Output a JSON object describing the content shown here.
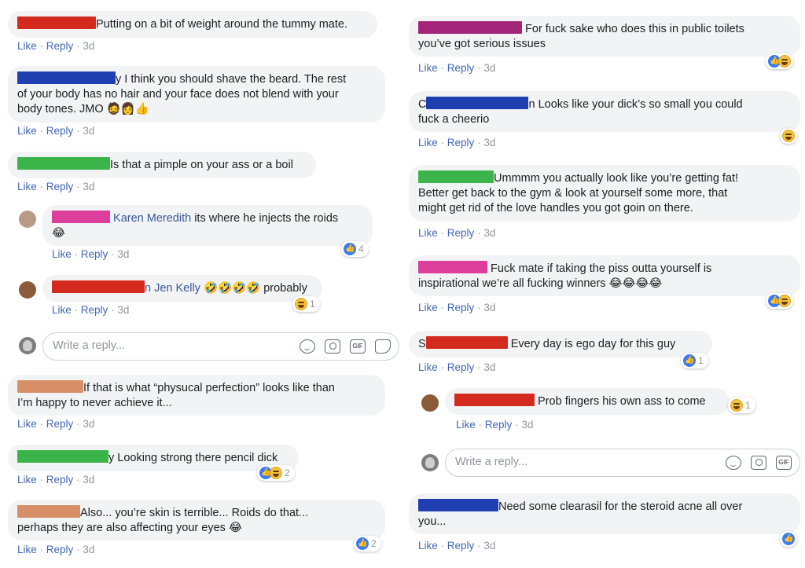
{
  "labels": {
    "like": "Like",
    "reply": "Reply",
    "sep": "·",
    "time": "3d"
  },
  "redact_colors": {
    "red": "#d42a1e",
    "blue": "#1f3fb0",
    "green": "#3bb54a",
    "pink": "#db3e9b",
    "tan": "#d68f66",
    "purple": "#a3257a"
  },
  "left": {
    "c1": {
      "text": "Putting on a bit of weight around the tummy mate."
    },
    "c2": {
      "line1": "y I think you should shave the beard. The rest",
      "line2": "of your body has no hair and your face does not blend with your",
      "line3": "body tones. JMO 🧔👩👍"
    },
    "c3": {
      "text": "Is that a pimple on your ass or a boil"
    },
    "c4": {
      "name": "Karen Meredith",
      "text": " its where he injects the roids",
      "emoji": "😂",
      "react_count": "4"
    },
    "c5": {
      "name": "n Jen Kelly",
      "emojis": "🤣🤣🤣🤣",
      "text": " probably",
      "react_count": "1"
    },
    "reply_placeholder": "Write a reply...",
    "c6": {
      "line1": "If that is what “physucal perfection” looks like than",
      "line2": "I’m happy to never achieve it..."
    },
    "c7": {
      "text": "y Looking strong there pencil dick",
      "react_count": "2"
    },
    "c8": {
      "line1": "Also... you’re skin is terrible... Roids do that...",
      "line2": "perhaps they are also affecting your eyes 😂",
      "react_count": "2"
    }
  },
  "right": {
    "c1": {
      "line1": "For fuck sake who does this in public toilets",
      "line2": "you’ve got serious issues"
    },
    "c2": {
      "prefix": "C",
      "line1": "n Looks like your dick’s so small you could",
      "line2": "fuck a cheerio"
    },
    "c3": {
      "line1": "Ummmm you actually look like you’re getting fat!",
      "line2": "Better get back to the gym & look at yourself some more, that",
      "line3": "might get rid of the love handles you got goin on there."
    },
    "c4": {
      "line1": "Fuck mate if taking the piss outta yourself is",
      "line2": "inspirational we’re all fucking winners 😂😂😂😂"
    },
    "c5": {
      "prefix": "S",
      "text": "Every day is ego day for this guy",
      "react_count": "1"
    },
    "c6": {
      "text": "Prob fingers his own ass to come",
      "react_count": "1"
    },
    "reply_placeholder": "Write a reply...",
    "c7": {
      "line1": "Need some clearasil for the steroid acne all over",
      "line2": "you..."
    }
  }
}
